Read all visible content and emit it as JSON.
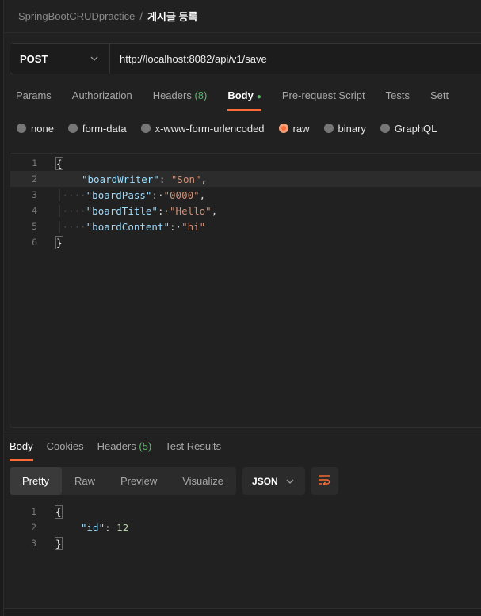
{
  "breadcrumb": {
    "collection": "SpringBootCRUDpractice",
    "separator": "/",
    "request": "게시글 등록"
  },
  "urlbar": {
    "method": "POST",
    "url": "http://localhost:8082/api/v1/save"
  },
  "request_tabs": [
    {
      "label": "Params"
    },
    {
      "label": "Authorization"
    },
    {
      "label": "Headers",
      "count": "(8)"
    },
    {
      "label": "Body",
      "active": true
    },
    {
      "label": "Pre-request Script"
    },
    {
      "label": "Tests"
    },
    {
      "label": "Sett"
    }
  ],
  "body_types": [
    {
      "label": "none"
    },
    {
      "label": "form-data"
    },
    {
      "label": "x-www-form-urlencoded"
    },
    {
      "label": "raw",
      "selected": true
    },
    {
      "label": "binary"
    },
    {
      "label": "GraphQL"
    }
  ],
  "request_body": {
    "line_numbers": [
      "1",
      "2",
      "3",
      "4",
      "5",
      "6"
    ],
    "open_brace": "{",
    "close_brace": "}",
    "fields": [
      {
        "key": "\"boardWriter\"",
        "value": "\"Son\"",
        "comma": ","
      },
      {
        "key": "\"boardPass\"",
        "value": "\"0000\"",
        "comma": ","
      },
      {
        "key": "\"boardTitle\"",
        "value": "\"Hello\"",
        "comma": ","
      },
      {
        "key": "\"boardContent\"",
        "value": "\"hi\"",
        "comma": ""
      }
    ]
  },
  "response_tabs": [
    {
      "label": "Body",
      "active": true
    },
    {
      "label": "Cookies"
    },
    {
      "label": "Headers",
      "count": "(5)"
    },
    {
      "label": "Test Results"
    }
  ],
  "view_modes": [
    {
      "label": "Pretty",
      "active": true
    },
    {
      "label": "Raw"
    },
    {
      "label": "Preview"
    },
    {
      "label": "Visualize"
    }
  ],
  "format": "JSON",
  "response_body": {
    "line_numbers": [
      "1",
      "2",
      "3"
    ],
    "open_brace": "{",
    "close_brace": "}",
    "key": "\"id\"",
    "value": "12"
  },
  "colors": {
    "accent": "#ff6c37",
    "count_green": "#5ab767",
    "json_key": "#9cdcfe",
    "json_string": "#ce9178",
    "json_number": "#b5cea8"
  },
  "icons": {
    "method_dropdown": "chevron-down-icon",
    "format_dropdown": "chevron-down-icon",
    "wrap": "wrap-lines-icon"
  }
}
